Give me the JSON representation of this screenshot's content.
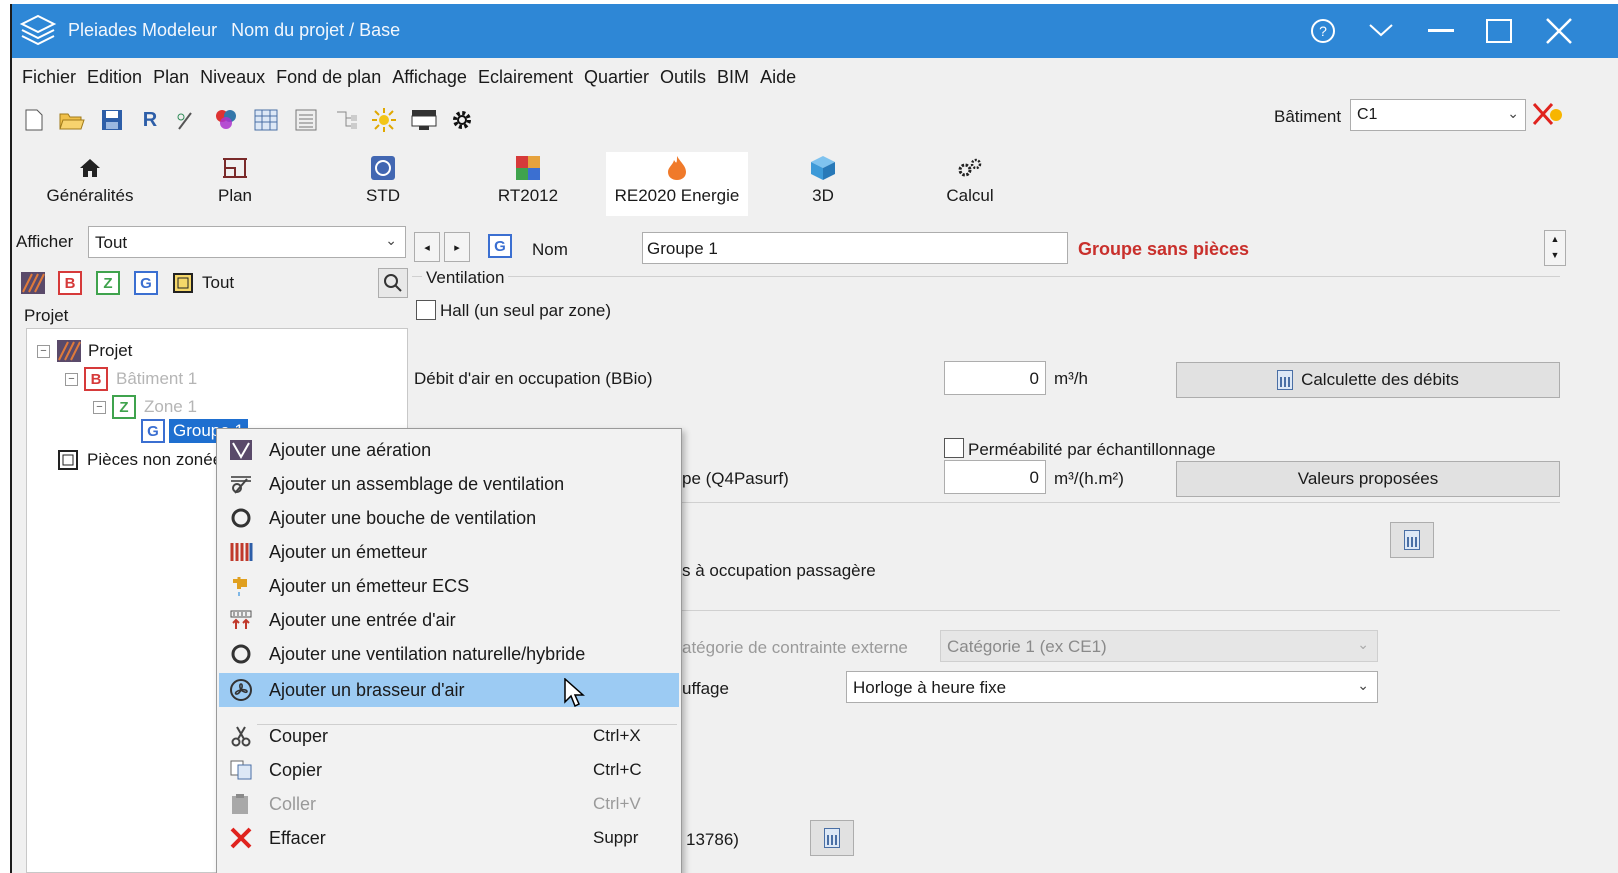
{
  "window": {
    "app_name": "Pleiades Modeleur",
    "project_path": "Nom du projet / Base",
    "controls": [
      "help-icon",
      "collapse-icon",
      "minimize-icon",
      "maximize-icon",
      "close-icon"
    ]
  },
  "menu": [
    "Fichier",
    "Edition",
    "Plan",
    "Niveaux",
    "Fond de plan",
    "Affichage",
    "Eclairement",
    "Quartier",
    "Outils",
    "BIM",
    "Aide"
  ],
  "toolbar": {
    "icons": [
      "new-file-icon",
      "open-folder-icon",
      "save-icon",
      "r-icon",
      "wand-icon",
      "palette-icon",
      "table-icon",
      "list-icon",
      "tree-icon",
      "sun-icon",
      "monitor-icon",
      "settings-icon"
    ],
    "batiment_label": "Bâtiment",
    "batiment_value": "C1"
  },
  "tabs": [
    {
      "label": "Généralités",
      "icon": "home-icon"
    },
    {
      "label": "Plan",
      "icon": "plan-icon"
    },
    {
      "label": "STD",
      "icon": "std-icon"
    },
    {
      "label": "RT2012",
      "icon": "rt2012-icon"
    },
    {
      "label": "RE2020 Energie",
      "icon": "flame-icon",
      "active": true
    },
    {
      "label": "3D",
      "icon": "cube-icon"
    },
    {
      "label": "Calcul",
      "icon": "gears-icon"
    }
  ],
  "left": {
    "afficher_label": "Afficher",
    "afficher_value": "Tout",
    "filters": {
      "b": "B",
      "z": "Z",
      "g": "G",
      "tout": "Tout"
    },
    "tree_header": "Projet",
    "tree": {
      "projet": "Projet",
      "batiment": "Bâtiment 1",
      "zone": "Zone 1",
      "groupe": "Groupe 1",
      "pieces": "Pièces non zonées"
    }
  },
  "right": {
    "nom_label": "Nom",
    "nom_value": "Groupe 1",
    "warning": "Groupe sans pièces",
    "ventilation_label": "Ventilation",
    "hall_label": "Hall (un seul par zone)",
    "debit_label": "Débit d'air en occupation (BBio)",
    "debit_value": "0",
    "debit_unit": "m³/h",
    "calculette_label": "Calculette des débits",
    "permeabilite_label": "Perméabilité par échantillonnage",
    "q4_label_partial": "pe (Q4Pasurf)",
    "q4_value": "0",
    "q4_unit": "m³/(h.m²)",
    "valeurs_label": "Valeurs proposées",
    "occupation_partial": "s à occupation passagère",
    "contrainte_label_partial": "atégorie de contrainte externe",
    "contrainte_value": "Catégorie 1 (ex CE1)",
    "chauffage_label_partial": "uffage",
    "chauffage_value": "Horloge à heure fixe",
    "bottom_partial": "13786)"
  },
  "context_menu": [
    {
      "label": "Ajouter une aération",
      "icon": "aeration-icon"
    },
    {
      "label": "Ajouter un assemblage de ventilation",
      "icon": "assembly-icon"
    },
    {
      "label": "Ajouter une bouche de ventilation",
      "icon": "vent-outlet-icon"
    },
    {
      "label": "Ajouter un émetteur",
      "icon": "radiator-icon"
    },
    {
      "label": "Ajouter un émetteur ECS",
      "icon": "faucet-icon"
    },
    {
      "label": "Ajouter une entrée d'air",
      "icon": "air-inlet-icon"
    },
    {
      "label": "Ajouter une ventilation naturelle/hybride",
      "icon": "natural-vent-icon"
    },
    {
      "label": "Ajouter un brasseur d'air",
      "icon": "fan-icon",
      "highlighted": true
    },
    {
      "label": "Couper",
      "shortcut": "Ctrl+X",
      "icon": "scissors-icon"
    },
    {
      "label": "Copier",
      "shortcut": "Ctrl+C",
      "icon": "copy-icon"
    },
    {
      "label": "Coller",
      "shortcut": "Ctrl+V",
      "icon": "paste-icon",
      "disabled": true
    },
    {
      "label": "Effacer",
      "shortcut": "Suppr",
      "icon": "delete-icon"
    }
  ],
  "colors": {
    "titlebar": "#2e87d6",
    "warning": "#c9302c",
    "highlight": "#9ccbf3",
    "selected": "#1e6fd0"
  }
}
